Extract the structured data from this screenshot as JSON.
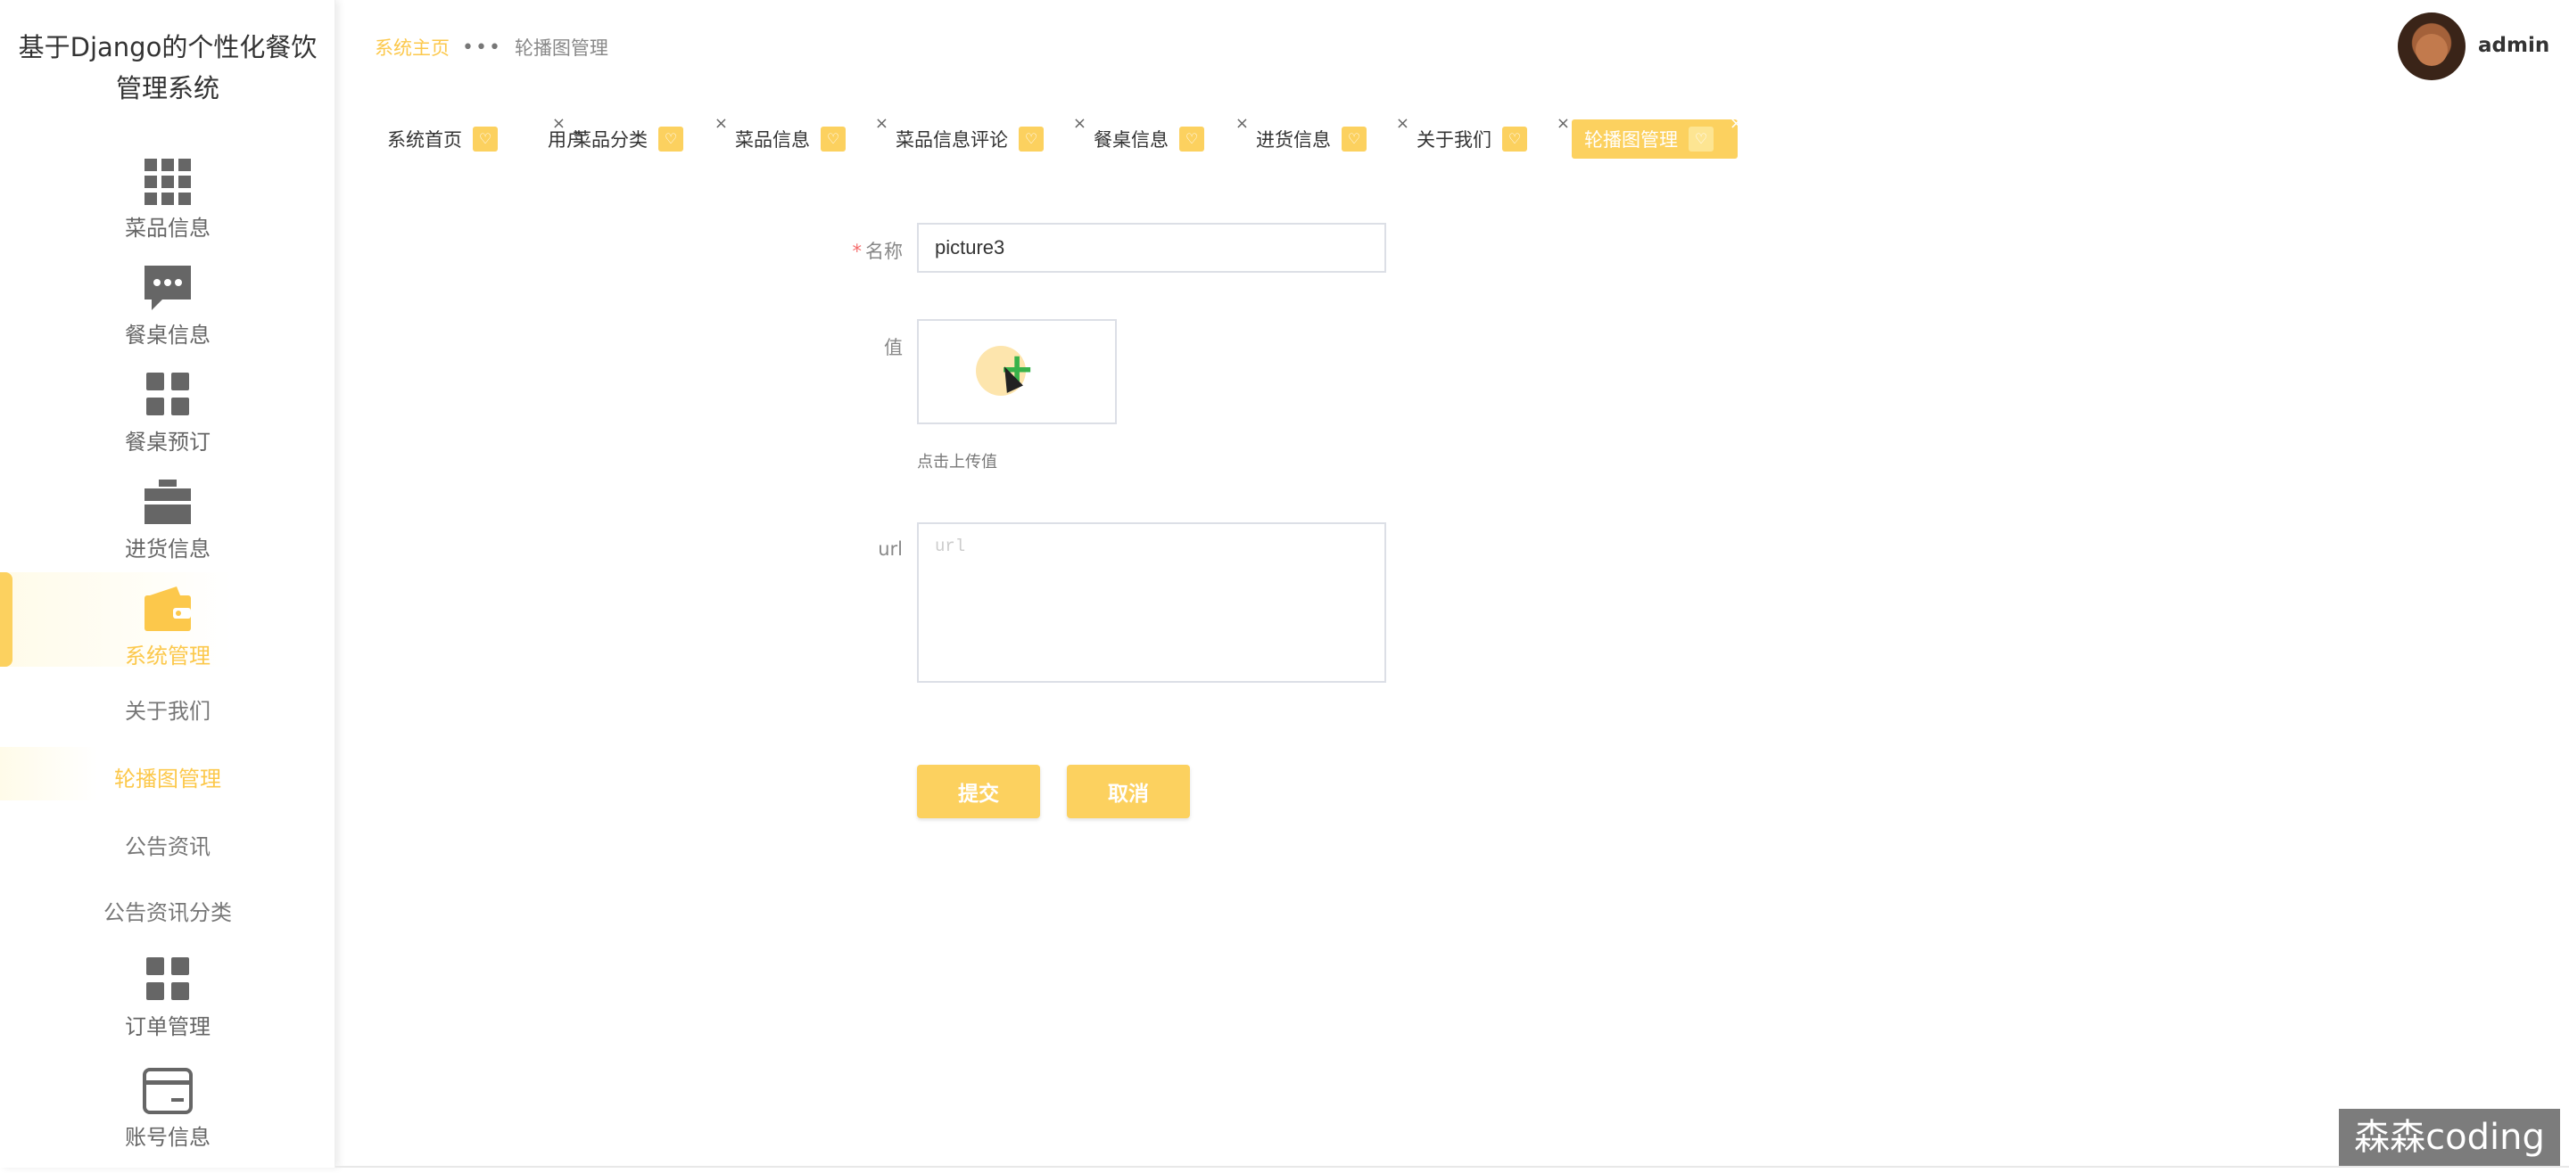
{
  "app": {
    "title": "基于Django的个性化餐饮管理系统",
    "title_line1": "基于Django的个性化餐饮",
    "title_line2": "管理系统"
  },
  "sidebar": {
    "items": [
      {
        "label": "菜品信息",
        "icon": "grid-icon"
      },
      {
        "label": "餐桌信息",
        "icon": "chat-icon"
      },
      {
        "label": "餐桌预订",
        "icon": "tiles-icon"
      },
      {
        "label": "进货信息",
        "icon": "briefcase-icon"
      },
      {
        "label": "系统管理",
        "icon": "wallet-icon",
        "active": true
      },
      {
        "label": "订单管理",
        "icon": "tiles-icon"
      },
      {
        "label": "账号信息",
        "icon": "card-icon"
      }
    ],
    "subitems": [
      {
        "label": "关于我们"
      },
      {
        "label": "轮播图管理",
        "active": true
      },
      {
        "label": "公告资讯"
      },
      {
        "label": "公告资讯分类"
      }
    ],
    "accent_color": "#fcc84b"
  },
  "header": {
    "breadcrumb_home": "系统主页",
    "breadcrumb_sep": "•••",
    "breadcrumb_current": "轮播图管理",
    "username": "admin"
  },
  "tabs": [
    {
      "label": "系统首页",
      "closable": false
    },
    {
      "label": "用户",
      "closable": true
    },
    {
      "label": "菜品分类",
      "closable": true
    },
    {
      "label": "菜品信息",
      "closable": true
    },
    {
      "label": "菜品信息评论",
      "closable": true
    },
    {
      "label": "餐桌信息",
      "closable": true
    },
    {
      "label": "进货信息",
      "closable": true
    },
    {
      "label": "关于我们",
      "closable": true
    },
    {
      "label": "轮播图管理",
      "closable": true,
      "active": true
    }
  ],
  "form": {
    "name_label": "名称",
    "name_required": "*",
    "name_value": "picture3",
    "value_label": "值",
    "upload_hint": "点击上传值",
    "url_label": "url",
    "url_placeholder": "url",
    "submit_label": "提交",
    "cancel_label": "取消"
  },
  "watermark": "森森coding"
}
